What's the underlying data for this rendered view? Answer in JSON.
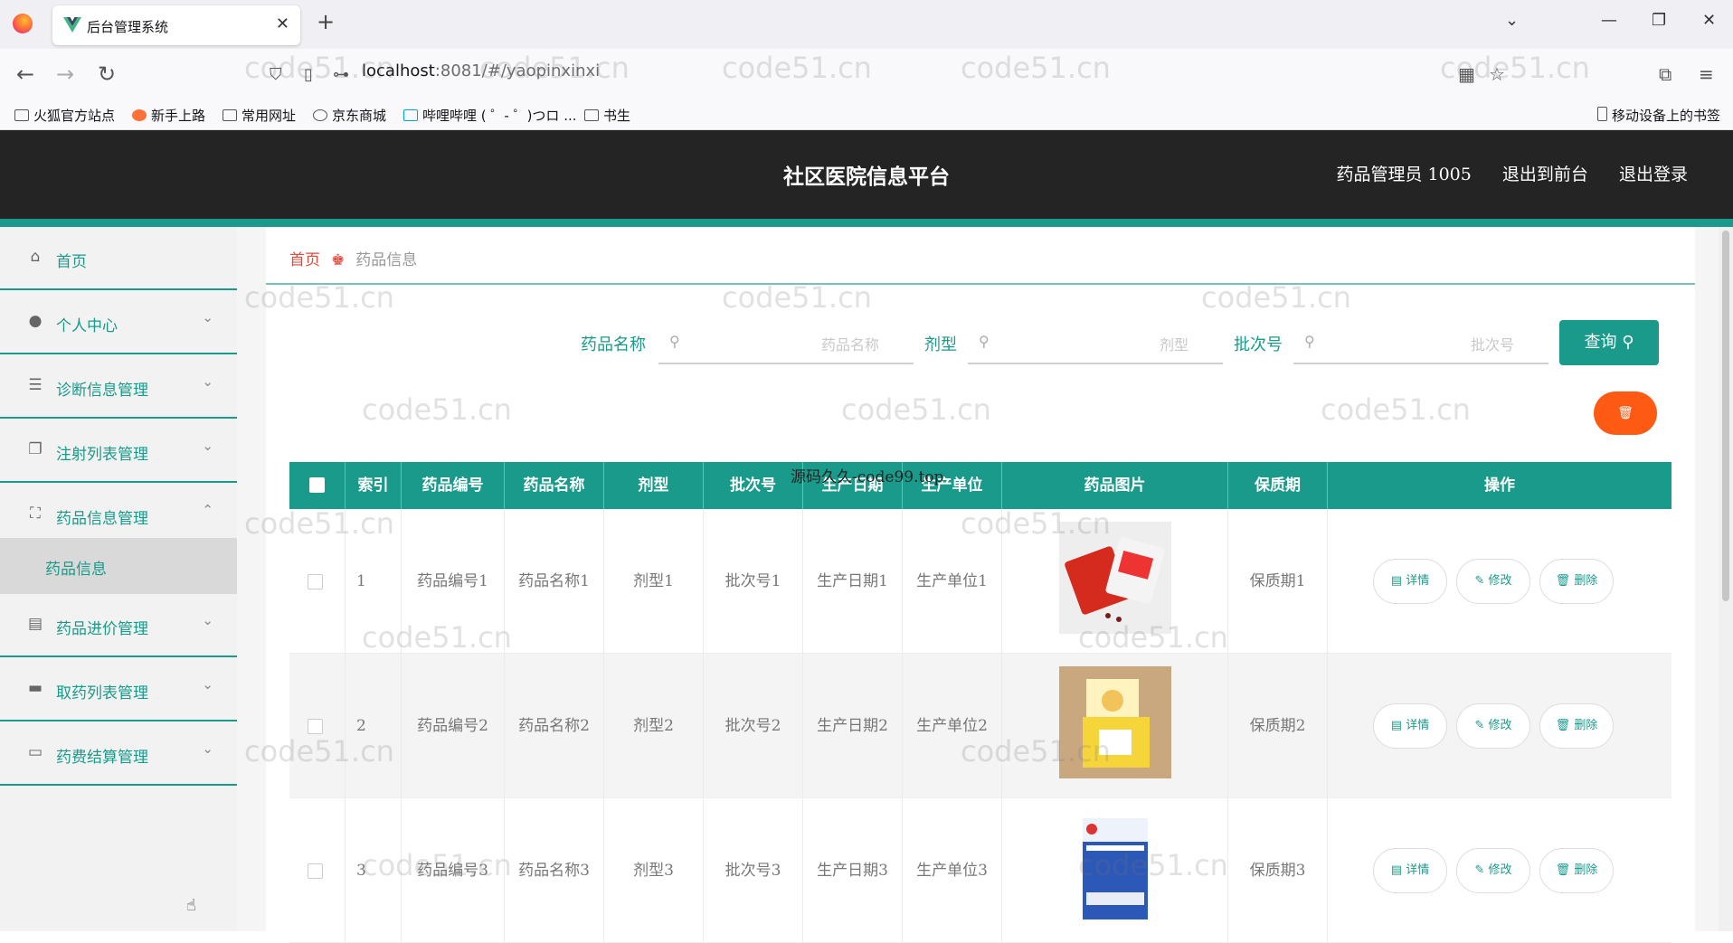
{
  "browser": {
    "tab_title": "后台管理系统",
    "url_host": "localhost",
    "url_rest": ":8081/#/yaopinxinxi",
    "bookmarks": [
      "火狐官方站点",
      "新手上路",
      "常用网址",
      "京东商城",
      "哔哩哔哩 ( ゜- ゜)つロ ...",
      "书生"
    ],
    "mobile_bookmarks": "移动设备上的书签"
  },
  "header": {
    "title": "社区医院信息平台",
    "user": "药品管理员 1005",
    "to_front": "退出到前台",
    "logout": "退出登录"
  },
  "sidebar": {
    "items": [
      {
        "label": "首页",
        "icon": "home-icon"
      },
      {
        "label": "个人中心",
        "icon": "user-icon"
      },
      {
        "label": "诊断信息管理",
        "icon": "sliders-icon"
      },
      {
        "label": "注射列表管理",
        "icon": "copy-icon"
      },
      {
        "label": "药品信息管理",
        "icon": "scan-icon",
        "expanded": true
      },
      {
        "label": "药品进价管理",
        "icon": "clipboard-icon"
      },
      {
        "label": "取药列表管理",
        "icon": "briefcase-icon"
      },
      {
        "label": "药费结算管理",
        "icon": "monitor-icon"
      }
    ],
    "sub_item": "药品信息"
  },
  "breadcrumb": {
    "home": "首页",
    "current": "药品信息"
  },
  "search": {
    "name_label": "药品名称",
    "name_placeholder": "药品名称",
    "type_label": "剂型",
    "type_placeholder": "剂型",
    "batch_label": "批次号",
    "batch_placeholder": "批次号",
    "query_label": "查询"
  },
  "table": {
    "headers": [
      "索引",
      "药品编号",
      "药品名称",
      "剂型",
      "批次号",
      "生产日期",
      "生产单位",
      "药品图片",
      "保质期",
      "操作"
    ],
    "rows": [
      {
        "idx": "1",
        "code": "药品编号1",
        "name": "药品名称1",
        "type": "剂型1",
        "batch": "批次号1",
        "date": "生产日期1",
        "maker": "生产单位1",
        "shelf": "保质期1"
      },
      {
        "idx": "2",
        "code": "药品编号2",
        "name": "药品名称2",
        "type": "剂型2",
        "batch": "批次号2",
        "date": "生产日期2",
        "maker": "生产单位2",
        "shelf": "保质期2"
      },
      {
        "idx": "3",
        "code": "药品编号3",
        "name": "药品名称3",
        "type": "剂型3",
        "batch": "批次号3",
        "date": "生产日期3",
        "maker": "生产单位3",
        "shelf": "保质期3"
      }
    ],
    "actions": {
      "detail": "详情",
      "edit": "修改",
      "delete": "删除"
    }
  },
  "overlay_text": "源码久久-code99.top",
  "watermark": "code51.cn",
  "colors": {
    "accent": "#1a9a8a",
    "danger": "#ff5a14",
    "header_bg": "#242424"
  }
}
